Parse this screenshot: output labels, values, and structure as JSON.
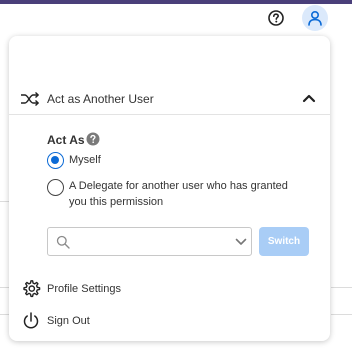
{
  "header": {
    "help_icon": "help-circle-icon",
    "user_icon": "user-icon",
    "band_color": "#4a3f7a"
  },
  "panel": {
    "section_title": "Act as Another User",
    "act_as": {
      "label": "Act As",
      "options": [
        {
          "label": "Myself",
          "selected": true
        },
        {
          "label_line1": "A Delegate for another user who has granted",
          "label_line2": "you this permission",
          "selected": false
        }
      ],
      "search": {
        "placeholder": "",
        "value": ""
      },
      "switch_label": "Switch"
    },
    "menu": {
      "profile_settings": "Profile Settings",
      "sign_out": "Sign Out"
    }
  },
  "colors": {
    "accent": "#0b6ad6",
    "switch_disabled": "#a9cdf6",
    "user_avatar_bg": "#dbe9fb"
  }
}
